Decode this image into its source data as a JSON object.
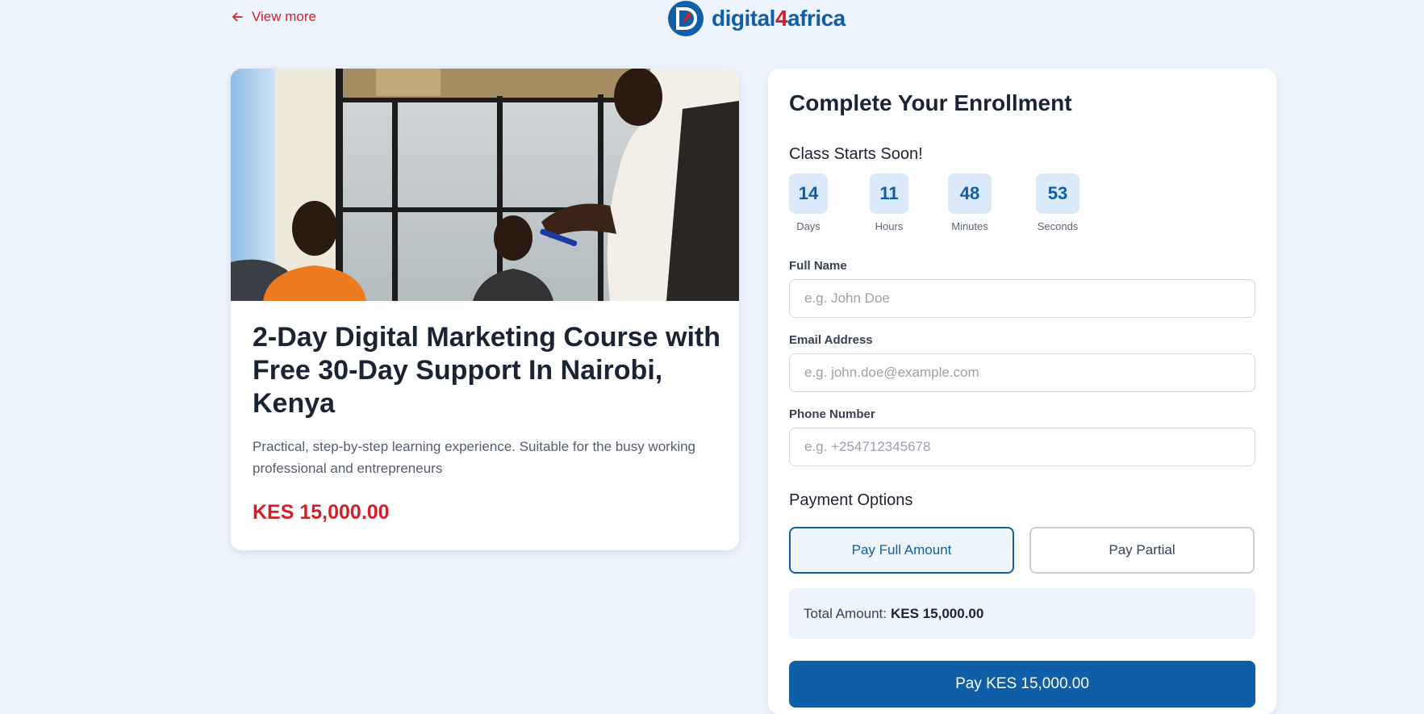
{
  "header": {
    "back_link": "View more",
    "logo": {
      "name": "digital4africa",
      "part1": "digital",
      "part2": "4",
      "part3": "africa"
    }
  },
  "course": {
    "image_alt": "Instructor presenting to students",
    "title": "2-Day Digital Marketing Course with Free 30-Day Support In Nairobi, Kenya",
    "description": "Practical, step-by-step learning experience. Suitable for the busy working professional and entrepreneurs",
    "price": "KES 15,000.00"
  },
  "enrollment": {
    "title": "Complete Your Enrollment",
    "countdown_heading": "Class Starts Soon!",
    "countdown": [
      {
        "value": "14",
        "label": "Days"
      },
      {
        "value": "11",
        "label": "Hours"
      },
      {
        "value": "48",
        "label": "Minutes"
      },
      {
        "value": "53",
        "label": "Seconds"
      }
    ],
    "fields": [
      {
        "label": "Full Name",
        "placeholder": "e.g. John Doe",
        "value": ""
      },
      {
        "label": "Email Address",
        "placeholder": "e.g. john.doe@example.com",
        "value": ""
      },
      {
        "label": "Phone Number",
        "placeholder": "e.g. +254712345678",
        "value": ""
      }
    ],
    "payment_heading": "Payment Options",
    "payment_options": [
      {
        "label": "Pay Full Amount",
        "selected": true
      },
      {
        "label": "Pay Partial",
        "selected": false
      }
    ],
    "total_label": "Total Amount:",
    "total_value": "KES 15,000.00",
    "pay_button": "Pay KES 15,000.00"
  },
  "colors": {
    "brand_blue": "#0f5ea7",
    "accent_red": "#d31f26",
    "background": "#eef4fd"
  },
  "icons": [
    "arrow-left-icon",
    "logo-mark-icon"
  ]
}
